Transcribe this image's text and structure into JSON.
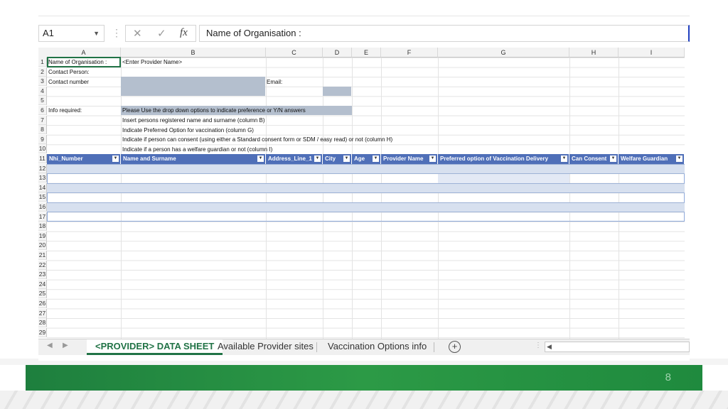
{
  "formula_bar": {
    "name_box": "A1",
    "cancel_icon": "✕",
    "enter_icon": "✓",
    "fx_label": "fx",
    "content": "Name of Organisation :"
  },
  "columns": [
    "A",
    "B",
    "C",
    "D",
    "E",
    "F",
    "G",
    "H",
    "I"
  ],
  "rows": [
    "1",
    "2",
    "3",
    "4",
    "5",
    "6",
    "7",
    "8",
    "9",
    "10",
    "11",
    "12",
    "13",
    "14",
    "15",
    "16",
    "17",
    "18",
    "19",
    "20",
    "21",
    "22",
    "23",
    "24",
    "25",
    "26",
    "27",
    "28",
    "29"
  ],
  "cells": {
    "a1": "Name of Organisation :",
    "b1": "<Enter Provider Name>",
    "a2": "Contact Person:",
    "a3": "Contact number",
    "c3": "Email:",
    "a5": "Info required:",
    "b5": "Please Use the drop down options to indicate preference or Y/N answers",
    "b6": "Insert persons registered name and surname (column B)",
    "b7": "Indicate Preferred Option for vaccination (column G)",
    "b8": "Indicate if person can consent (using either a Standard consent form or SDM / easy read) or not (column H)",
    "b9": "Indicate if a person has a welfare guardian or not (column I)"
  },
  "table_headers": [
    "Nhi_Number",
    "Name and Surname",
    "Address_Line_1",
    "City",
    "Age",
    "Provider Name",
    "Preferred option of Vaccination Delivery",
    "Can Consent",
    "Welfare Guardian"
  ],
  "sheet_tabs": [
    "<PROVIDER> DATA SHEET",
    "Available Provider sites",
    "Vaccination Options info"
  ],
  "add_sheet_label": "+",
  "page_number": "8",
  "colors": {
    "excel_green": "#217346",
    "table_header": "#4f6fb8",
    "band": "#d7e0ef",
    "shade": "#b4bfce",
    "footer_green": "#1e7f3e"
  }
}
